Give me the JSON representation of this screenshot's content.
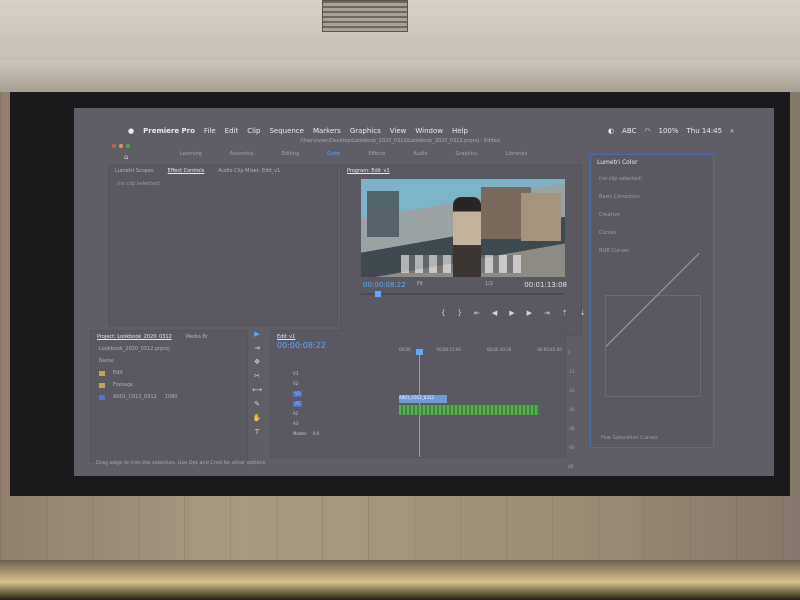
{
  "menubar": {
    "app_name": "Premiere Pro",
    "items": [
      "File",
      "Edit",
      "Clip",
      "Sequence",
      "Markers",
      "Graphics",
      "View",
      "Window",
      "Help"
    ],
    "clock": "Thu 14:45",
    "battery": "100%",
    "input_source": "ABC"
  },
  "title_path": "/Users/user/Desktop/Lookbook_2020_0312/Lookbook_2020_0312.prproj - Edited",
  "workspace_tabs": [
    "Learning",
    "Assembly",
    "Editing",
    "Color",
    "Effects",
    "Audio",
    "Graphics",
    "Libraries"
  ],
  "workspace_active": "Color",
  "effects_panel": {
    "tabs": [
      "Lumetri Scopes",
      "Effect Controls",
      "Audio Clip Mixer: Edit_v1"
    ],
    "active_tab": "Effect Controls",
    "placeholder": "(no clip selected)"
  },
  "program": {
    "title": "Program: Edit_v1",
    "timecode": "00:00:08:22",
    "duration": "00:01:13:08",
    "fit": "Fit",
    "resolution": "1/2",
    "playhead_progress": 0.07
  },
  "lumetri": {
    "title": "Lumetri Color",
    "no_selection": "(no clip selected)",
    "sections": [
      "Basic Correction",
      "Creative",
      "Curves"
    ],
    "curve_title": "RGB Curves",
    "bottom": "Hue Saturation Curves"
  },
  "project": {
    "title": "Project: Lookbook_2020_0312",
    "media_browser": "Media Br",
    "file": "Lookbook_2020_0312.prproj",
    "column": "Name",
    "items": [
      {
        "type": "folder",
        "name": "Edit"
      },
      {
        "type": "folder",
        "name": "Footage"
      },
      {
        "type": "clip",
        "name": "A001_C012_0312",
        "meta": "1080"
      }
    ]
  },
  "tools": [
    "▶",
    "⇥",
    "✥",
    "✂",
    "⟷",
    "✎",
    "✋",
    "T"
  ],
  "timeline": {
    "title": "Edit_v1",
    "timecode": "00:00:08:22",
    "ruler": [
      "00:00",
      "00:00:15:00",
      "00:00:30:00",
      "00:00:45:00"
    ],
    "tracks": [
      "V3",
      "V2",
      "V1",
      "A1",
      "A2",
      "A3"
    ],
    "mix": "Master",
    "mix_value": "0.0",
    "clip_label": "A001_C012_0312"
  },
  "meter": [
    "0",
    "-12",
    "-24",
    "-36",
    "-48",
    "-60",
    "dB"
  ],
  "status_text": "Drag edge to trim the selection. Use Opt and Cmd for other options."
}
